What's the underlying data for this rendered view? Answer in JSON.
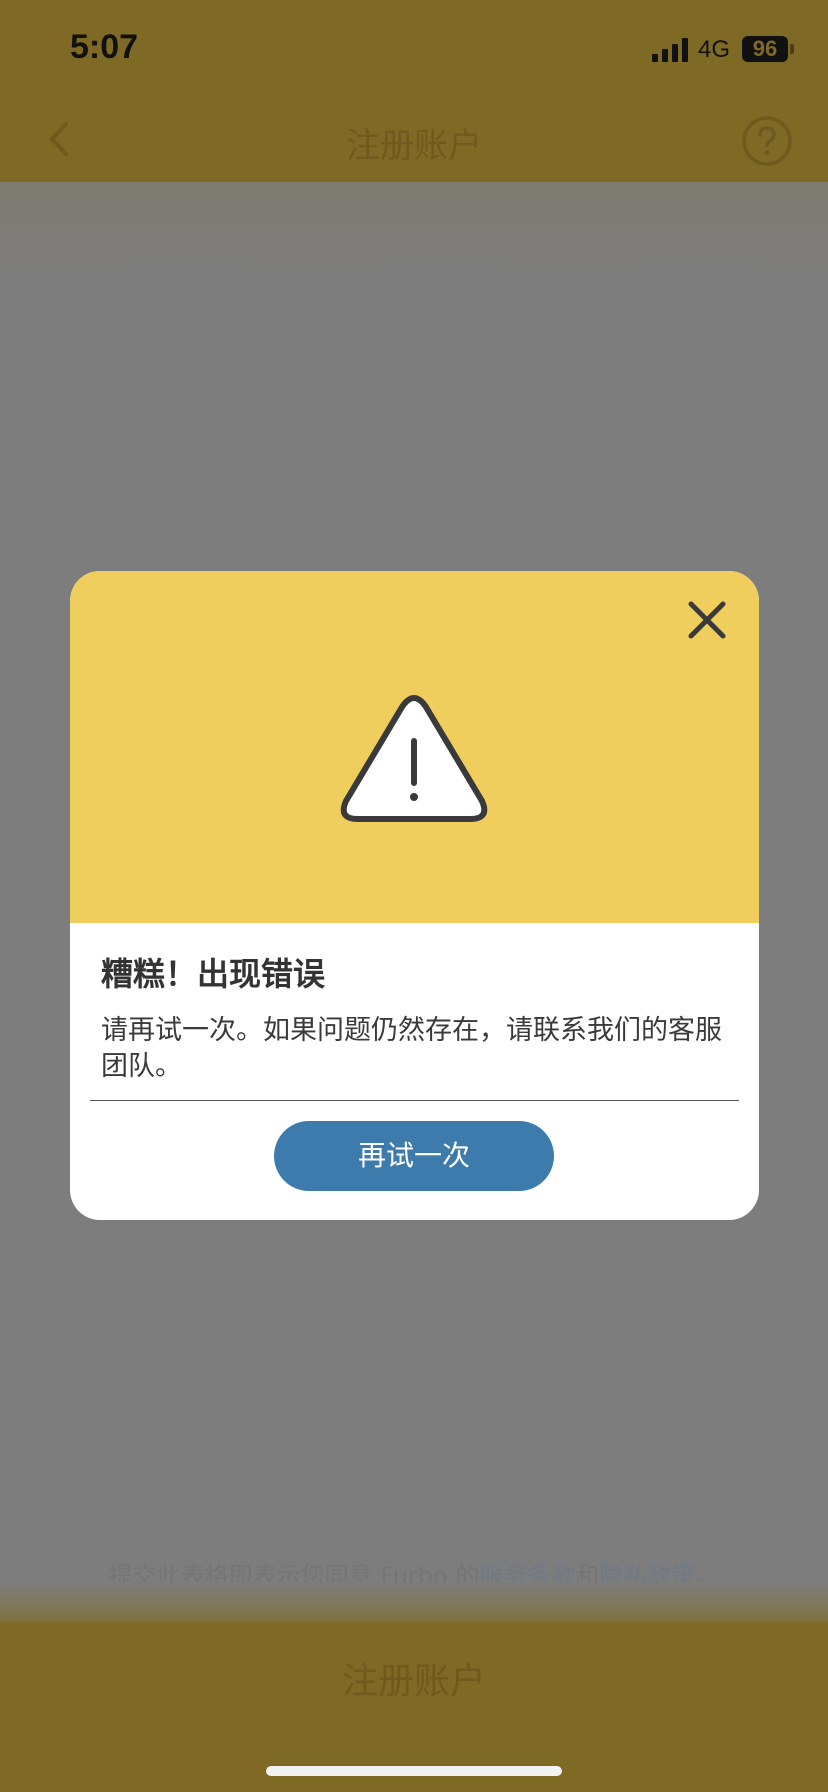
{
  "status_bar": {
    "time": "5:07",
    "network": "4G",
    "battery": "96"
  },
  "nav": {
    "title": "注册账户",
    "back_icon": "chevron-left-icon",
    "help_icon": "question-circle-icon"
  },
  "footer": {
    "terms_prefix": "提交此表格即表示您同意 Furbo 的",
    "terms_link": "服务条款",
    "terms_and": "和",
    "privacy_link": "隐私政策",
    "terms_suffix": "。",
    "register_button": "注册账户"
  },
  "modal": {
    "icon": "warning-triangle-icon",
    "close_icon": "close-icon",
    "title": "糟糕！出现错误",
    "message": "请再试一次。如果问题仍然存在，请联系我们的客服团队。",
    "retry_button": "再试一次"
  },
  "colors": {
    "header_yellow": "#f0ce5e",
    "primary_blue": "#3d7bac",
    "overlay": "#7d7d7d"
  }
}
